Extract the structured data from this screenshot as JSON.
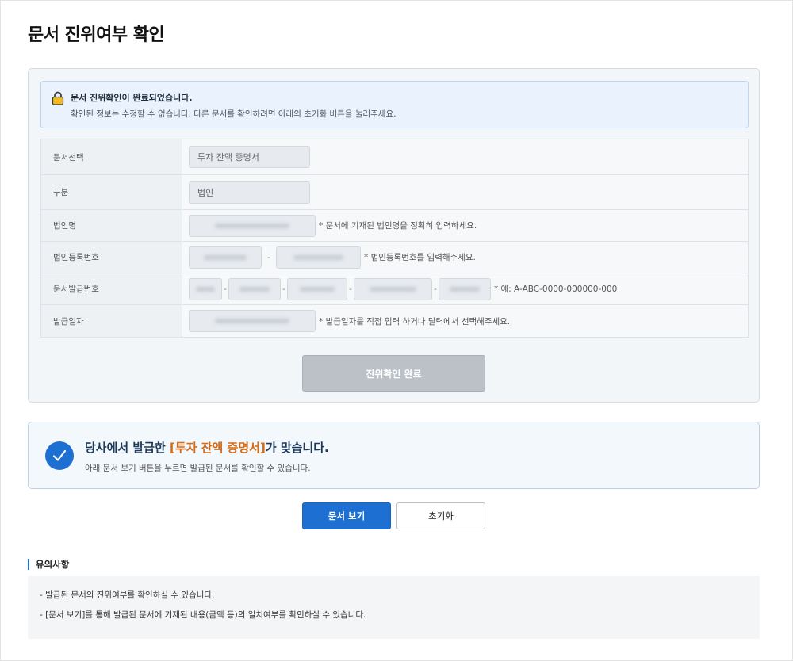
{
  "page": {
    "title": "문서 진위여부 확인"
  },
  "notice": {
    "title": "문서 진위확인이 완료되었습니다.",
    "description": "확인된 정보는 수정할 수 없습니다. 다른 문서를 확인하려면 아래의 초기화 버튼을 눌러주세요."
  },
  "form": {
    "document_select": {
      "label": "문서선택",
      "value": "투자 잔액 증명서"
    },
    "category": {
      "label": "구분",
      "value": "법인"
    },
    "corp_name": {
      "label": "법인명",
      "hint": "* 문서에 기재된 법인명을 정확히 입력하세요."
    },
    "corp_reg_no": {
      "label": "법인등록번호",
      "separator": "-",
      "hint": "* 법인등록번호를 입력해주세요."
    },
    "doc_issue_no": {
      "label": "문서발급번호",
      "separator": "-",
      "hint": "* 예: A-ABC-0000-000000-000"
    },
    "issue_date": {
      "label": "발급일자",
      "hint": "* 발급일자를 직접 입력 하거나 달력에서 선택해주세요."
    },
    "confirm_button": "진위확인 완료"
  },
  "result": {
    "title_prefix": "당사에서 발급한 ",
    "title_highlight": "[투자 잔액 증명서]",
    "title_suffix": "가 맞습니다.",
    "description": "아래 문서 보기 버튼을 누르면 발급된 문서를 확인할 수 있습니다."
  },
  "actions": {
    "view_label": "문서 보기",
    "reset_label": "초기화"
  },
  "notes": {
    "heading": "유의사항",
    "items": [
      "- 발급된 문서의 진위여부를 확인하실 수 있습니다.",
      "- [문서 보기]를 통해 발급된 문서에 기재된 내용(금액 등)의 일치여부를 확인하실 수 있습니다."
    ]
  },
  "colors": {
    "accent": "#1d6fd1",
    "highlight": "#d86a12",
    "disabled": "#bcc1c8"
  }
}
